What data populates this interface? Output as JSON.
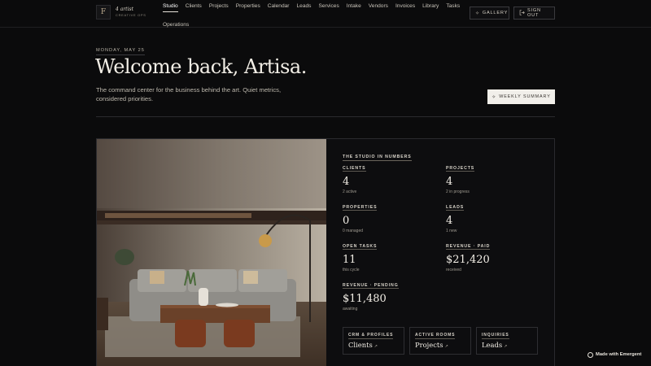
{
  "brand": {
    "mark": "F",
    "name": "4 artist",
    "sub": "CREATIVE OPS"
  },
  "nav": {
    "items": [
      "Studio",
      "Clients",
      "Projects",
      "Properties",
      "Calendar",
      "Leads",
      "Services",
      "Intake",
      "Vendors",
      "Invoices",
      "Library",
      "Tasks",
      "Operations"
    ],
    "active": "Studio"
  },
  "header": {
    "gallery_label": "GALLERY",
    "gallery_icon": "sparkle-icon",
    "signout_label": "SIGN OUT",
    "signout_icon": "logout-icon"
  },
  "hero": {
    "date": "MONDAY, MAY 25",
    "title": "Welcome back, Artisa.",
    "subtitle": "The command center for the business behind the art. Quiet metrics, considered priorities.",
    "weekly_label": "WEEKLY SUMMARY",
    "weekly_icon": "sparkle-icon"
  },
  "stats": {
    "heading": "THE STUDIO IN NUMBERS",
    "items": [
      {
        "label": "CLIENTS",
        "value": "4",
        "note": "2 active"
      },
      {
        "label": "PROJECTS",
        "value": "4",
        "note": "2 in progress"
      },
      {
        "label": "PROPERTIES",
        "value": "0",
        "note": "0 managed"
      },
      {
        "label": "LEADS",
        "value": "4",
        "note": "1 new"
      },
      {
        "label": "OPEN TASKS",
        "value": "11",
        "note": "this cycle"
      },
      {
        "label": "REVENUE · PAID",
        "value": "$21,420",
        "note": "received"
      },
      {
        "label": "REVENUE · PENDING",
        "value": "$11,480",
        "note": "awaiting"
      }
    ]
  },
  "quick_links": [
    {
      "label": "CRM & PROFILES",
      "value": "Clients",
      "arrow": "↗"
    },
    {
      "label": "ACTIVE ROOMS",
      "value": "Projects",
      "arrow": "↗"
    },
    {
      "label": "INQUIRIES",
      "value": "Leads",
      "arrow": "↗"
    }
  ],
  "badge": {
    "label": "Made with Emergent"
  },
  "colors": {
    "background": "#0b0b0c",
    "panel": "#0d0d0f",
    "text": "#f2eee6",
    "accent_button": "#f1efea"
  }
}
